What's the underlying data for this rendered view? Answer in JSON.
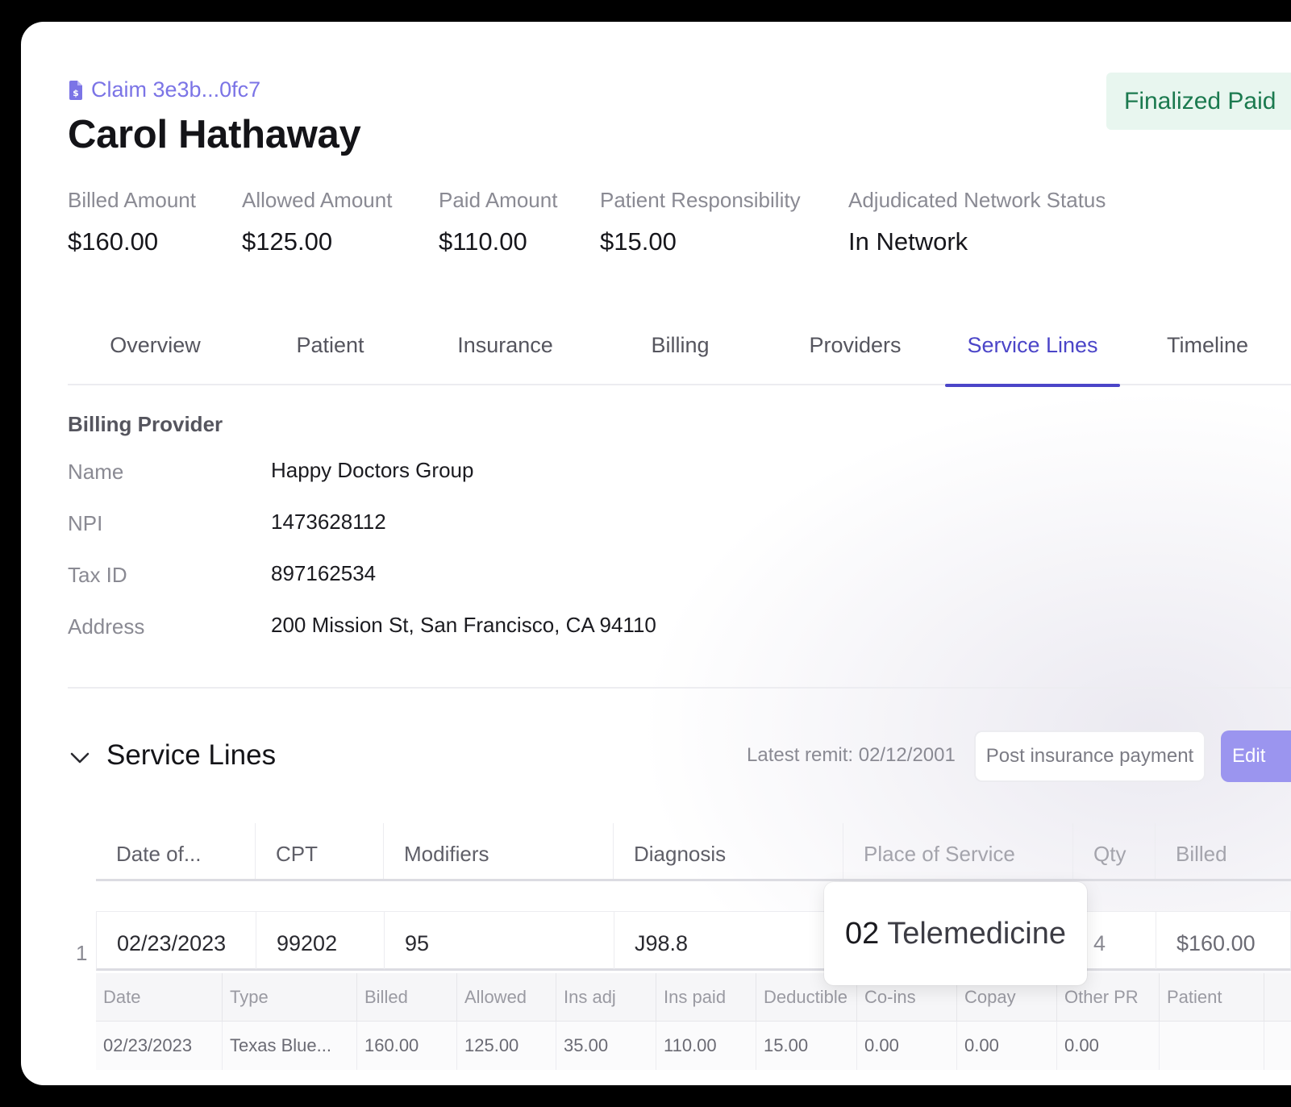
{
  "claim": {
    "label": "Claim 3e3b...0fc7",
    "patient_name": "Carol Hathaway",
    "status": "Finalized Paid"
  },
  "summary": [
    {
      "label": "Billed Amount",
      "value": "$160.00"
    },
    {
      "label": "Allowed Amount",
      "value": "$125.00"
    },
    {
      "label": "Paid Amount",
      "value": "$110.00"
    },
    {
      "label": "Patient Responsibility",
      "value": "$15.00"
    },
    {
      "label": "Adjudicated Network Status",
      "value": "In Network"
    }
  ],
  "tabs": [
    {
      "label": "Overview"
    },
    {
      "label": "Patient"
    },
    {
      "label": "Insurance"
    },
    {
      "label": "Billing"
    },
    {
      "label": "Providers"
    },
    {
      "label": "Service Lines",
      "active": true
    },
    {
      "label": "Timeline"
    }
  ],
  "billing_provider": {
    "title": "Billing Provider",
    "fields": [
      {
        "key": "Name",
        "value": "Happy Doctors Group"
      },
      {
        "key": "NPI",
        "value": "1473628112"
      },
      {
        "key": "Tax ID",
        "value": "897162534"
      },
      {
        "key": "Address",
        "value": "200 Mission St, San Francisco, CA 94110"
      }
    ]
  },
  "service_lines": {
    "title": "Service Lines",
    "latest_remit_label": "Latest remit:",
    "latest_remit_date": "02/12/2001",
    "post_payment_label": "Post insurance payment",
    "edit_label": "Edit",
    "columns": [
      "Date of...",
      "CPT",
      "Modifiers",
      "Diagnosis",
      "Place of Service",
      "Qty",
      "Billed"
    ],
    "rows": [
      {
        "number": "1",
        "date": "02/23/2023",
        "cpt": "99202",
        "modifiers": "95",
        "diagnosis": "J98.8",
        "place_of_service": "",
        "qty": "4",
        "billed": "$160.00"
      }
    ],
    "payment_columns": [
      "Date",
      "Type",
      "Billed",
      "Allowed",
      "Ins adj",
      "Ins paid",
      "Deductible",
      "Co-ins",
      "Copay",
      "Other PR",
      "Patient"
    ],
    "payment_rows": [
      {
        "date": "02/23/2023",
        "type": "Texas Blue...",
        "billed": "160.00",
        "allowed": "125.00",
        "ins_adj": "35.00",
        "ins_paid": "110.00",
        "deductible": "15.00",
        "co_ins": "0.00",
        "copay": "0.00",
        "other_pr": "0.00",
        "patient": ""
      }
    ]
  },
  "tooltip": {
    "code": "02",
    "description": "Telemedicine"
  },
  "colors": {
    "accent": "#4b45c8",
    "link": "#7b74e6",
    "status_bg": "#e8f6ef",
    "status_text": "#1b7a4f",
    "edit_button": "#9b95ef"
  },
  "icons": {
    "claim": "claim-document-icon",
    "toggle": "chevron-down-icon"
  }
}
